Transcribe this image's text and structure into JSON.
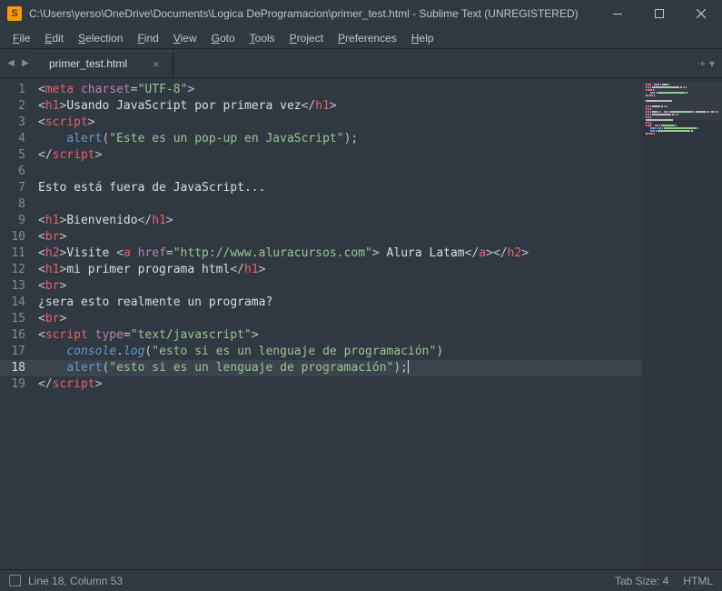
{
  "titlebar": {
    "title": "C:\\Users\\yerso\\OneDrive\\Documents\\Logica DeProgramacion\\primer_test.html - Sublime Text (UNREGISTERED)"
  },
  "menus": [
    "File",
    "Edit",
    "Selection",
    "Find",
    "View",
    "Goto",
    "Tools",
    "Project",
    "Preferences",
    "Help"
  ],
  "tab": {
    "label": "primer_test.html"
  },
  "cursor": {
    "line": 18,
    "column": 53
  },
  "statusbar": {
    "position": "Line 18, Column 53",
    "tabsize": "Tab Size: 4",
    "syntax": "HTML"
  },
  "lines": [
    [
      [
        "p",
        "<"
      ],
      [
        "t",
        "meta"
      ],
      [
        "p",
        " "
      ],
      [
        "a",
        "charset"
      ],
      [
        "p",
        "="
      ],
      [
        "s",
        "\"UTF-8\""
      ],
      [
        "p",
        ">"
      ]
    ],
    [
      [
        "p",
        "<"
      ],
      [
        "t",
        "h1"
      ],
      [
        "p",
        ">"
      ],
      [
        "tx",
        "Usando JavaScript por primera vez"
      ],
      [
        "p",
        "</"
      ],
      [
        "t",
        "h1"
      ],
      [
        "p",
        ">"
      ]
    ],
    [
      [
        "p",
        "<"
      ],
      [
        "t",
        "script"
      ],
      [
        "p",
        ">"
      ]
    ],
    [
      [
        "tx",
        "    "
      ],
      [
        "fn",
        "alert"
      ],
      [
        "p",
        "("
      ],
      [
        "s",
        "\"Este es un pop-up en JavaScript\""
      ],
      [
        "p",
        ");"
      ]
    ],
    [
      [
        "p",
        "</"
      ],
      [
        "t",
        "script"
      ],
      [
        "p",
        ">"
      ]
    ],
    [],
    [
      [
        "tx",
        "Esto está fuera de JavaScript..."
      ]
    ],
    [],
    [
      [
        "p",
        "<"
      ],
      [
        "t",
        "h1"
      ],
      [
        "p",
        ">"
      ],
      [
        "tx",
        "Bienvenido"
      ],
      [
        "p",
        "</"
      ],
      [
        "t",
        "h1"
      ],
      [
        "p",
        ">"
      ]
    ],
    [
      [
        "p",
        "<"
      ],
      [
        "t",
        "br"
      ],
      [
        "p",
        ">"
      ]
    ],
    [
      [
        "p",
        "<"
      ],
      [
        "t",
        "h2"
      ],
      [
        "p",
        ">"
      ],
      [
        "tx",
        "Visite "
      ],
      [
        "p",
        "<"
      ],
      [
        "t",
        "a"
      ],
      [
        "p",
        " "
      ],
      [
        "a",
        "href"
      ],
      [
        "p",
        "="
      ],
      [
        "s",
        "\"http://www.aluracursos.com\""
      ],
      [
        "p",
        ">"
      ],
      [
        "tx",
        " Alura Latam"
      ],
      [
        "p",
        "</"
      ],
      [
        "t",
        "a"
      ],
      [
        "p",
        "></"
      ],
      [
        "t",
        "h2"
      ],
      [
        "p",
        ">"
      ]
    ],
    [
      [
        "p",
        "<"
      ],
      [
        "t",
        "h1"
      ],
      [
        "p",
        ">"
      ],
      [
        "tx",
        "mi primer programa html"
      ],
      [
        "p",
        "</"
      ],
      [
        "t",
        "h1"
      ],
      [
        "p",
        ">"
      ]
    ],
    [
      [
        "p",
        "<"
      ],
      [
        "t",
        "br"
      ],
      [
        "p",
        ">"
      ]
    ],
    [
      [
        "tx",
        "¿sera esto realmente un programa?"
      ]
    ],
    [
      [
        "p",
        "<"
      ],
      [
        "t",
        "br"
      ],
      [
        "p",
        ">"
      ]
    ],
    [
      [
        "p",
        "<"
      ],
      [
        "t",
        "script"
      ],
      [
        "p",
        " "
      ],
      [
        "a",
        "type"
      ],
      [
        "p",
        "="
      ],
      [
        "s",
        "\"text/javascript\""
      ],
      [
        "p",
        ">"
      ]
    ],
    [
      [
        "tx",
        "    "
      ],
      [
        "ob",
        "console"
      ],
      [
        "p",
        "."
      ],
      [
        "me",
        "log"
      ],
      [
        "p",
        "("
      ],
      [
        "s",
        "\"esto si es un lenguaje de programación\""
      ],
      [
        "p",
        ")"
      ]
    ],
    [
      [
        "tx",
        "    "
      ],
      [
        "fn",
        "alert"
      ],
      [
        "p",
        "("
      ],
      [
        "s",
        "\"esto si es un lenguaje de programación\""
      ],
      [
        "p",
        ");"
      ]
    ],
    [
      [
        "p",
        "</"
      ],
      [
        "t",
        "script"
      ],
      [
        "p",
        ">"
      ]
    ]
  ],
  "minimap_colors": {
    "p": "#b5bac0",
    "t": "#eb606b",
    "a": "#bb80b3",
    "s": "#99c794",
    "k": "#eb606b",
    "fn": "#6699cc",
    "ob": "#6699cc",
    "me": "#6699cc",
    "tx": "#b5bac0"
  }
}
